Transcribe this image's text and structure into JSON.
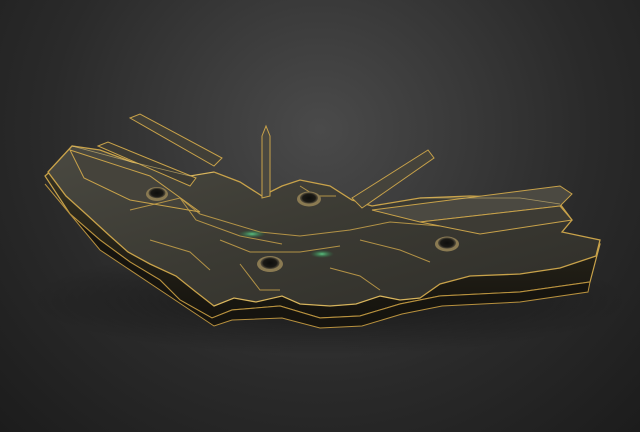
{
  "scene": {
    "background_color": "#2b2b2b",
    "plate_color": "#3b3a33",
    "edge_glow_color": "#c8a24a",
    "hole_accent_color": "#d4b25c",
    "light_accent_color": "#3fae6a"
  }
}
